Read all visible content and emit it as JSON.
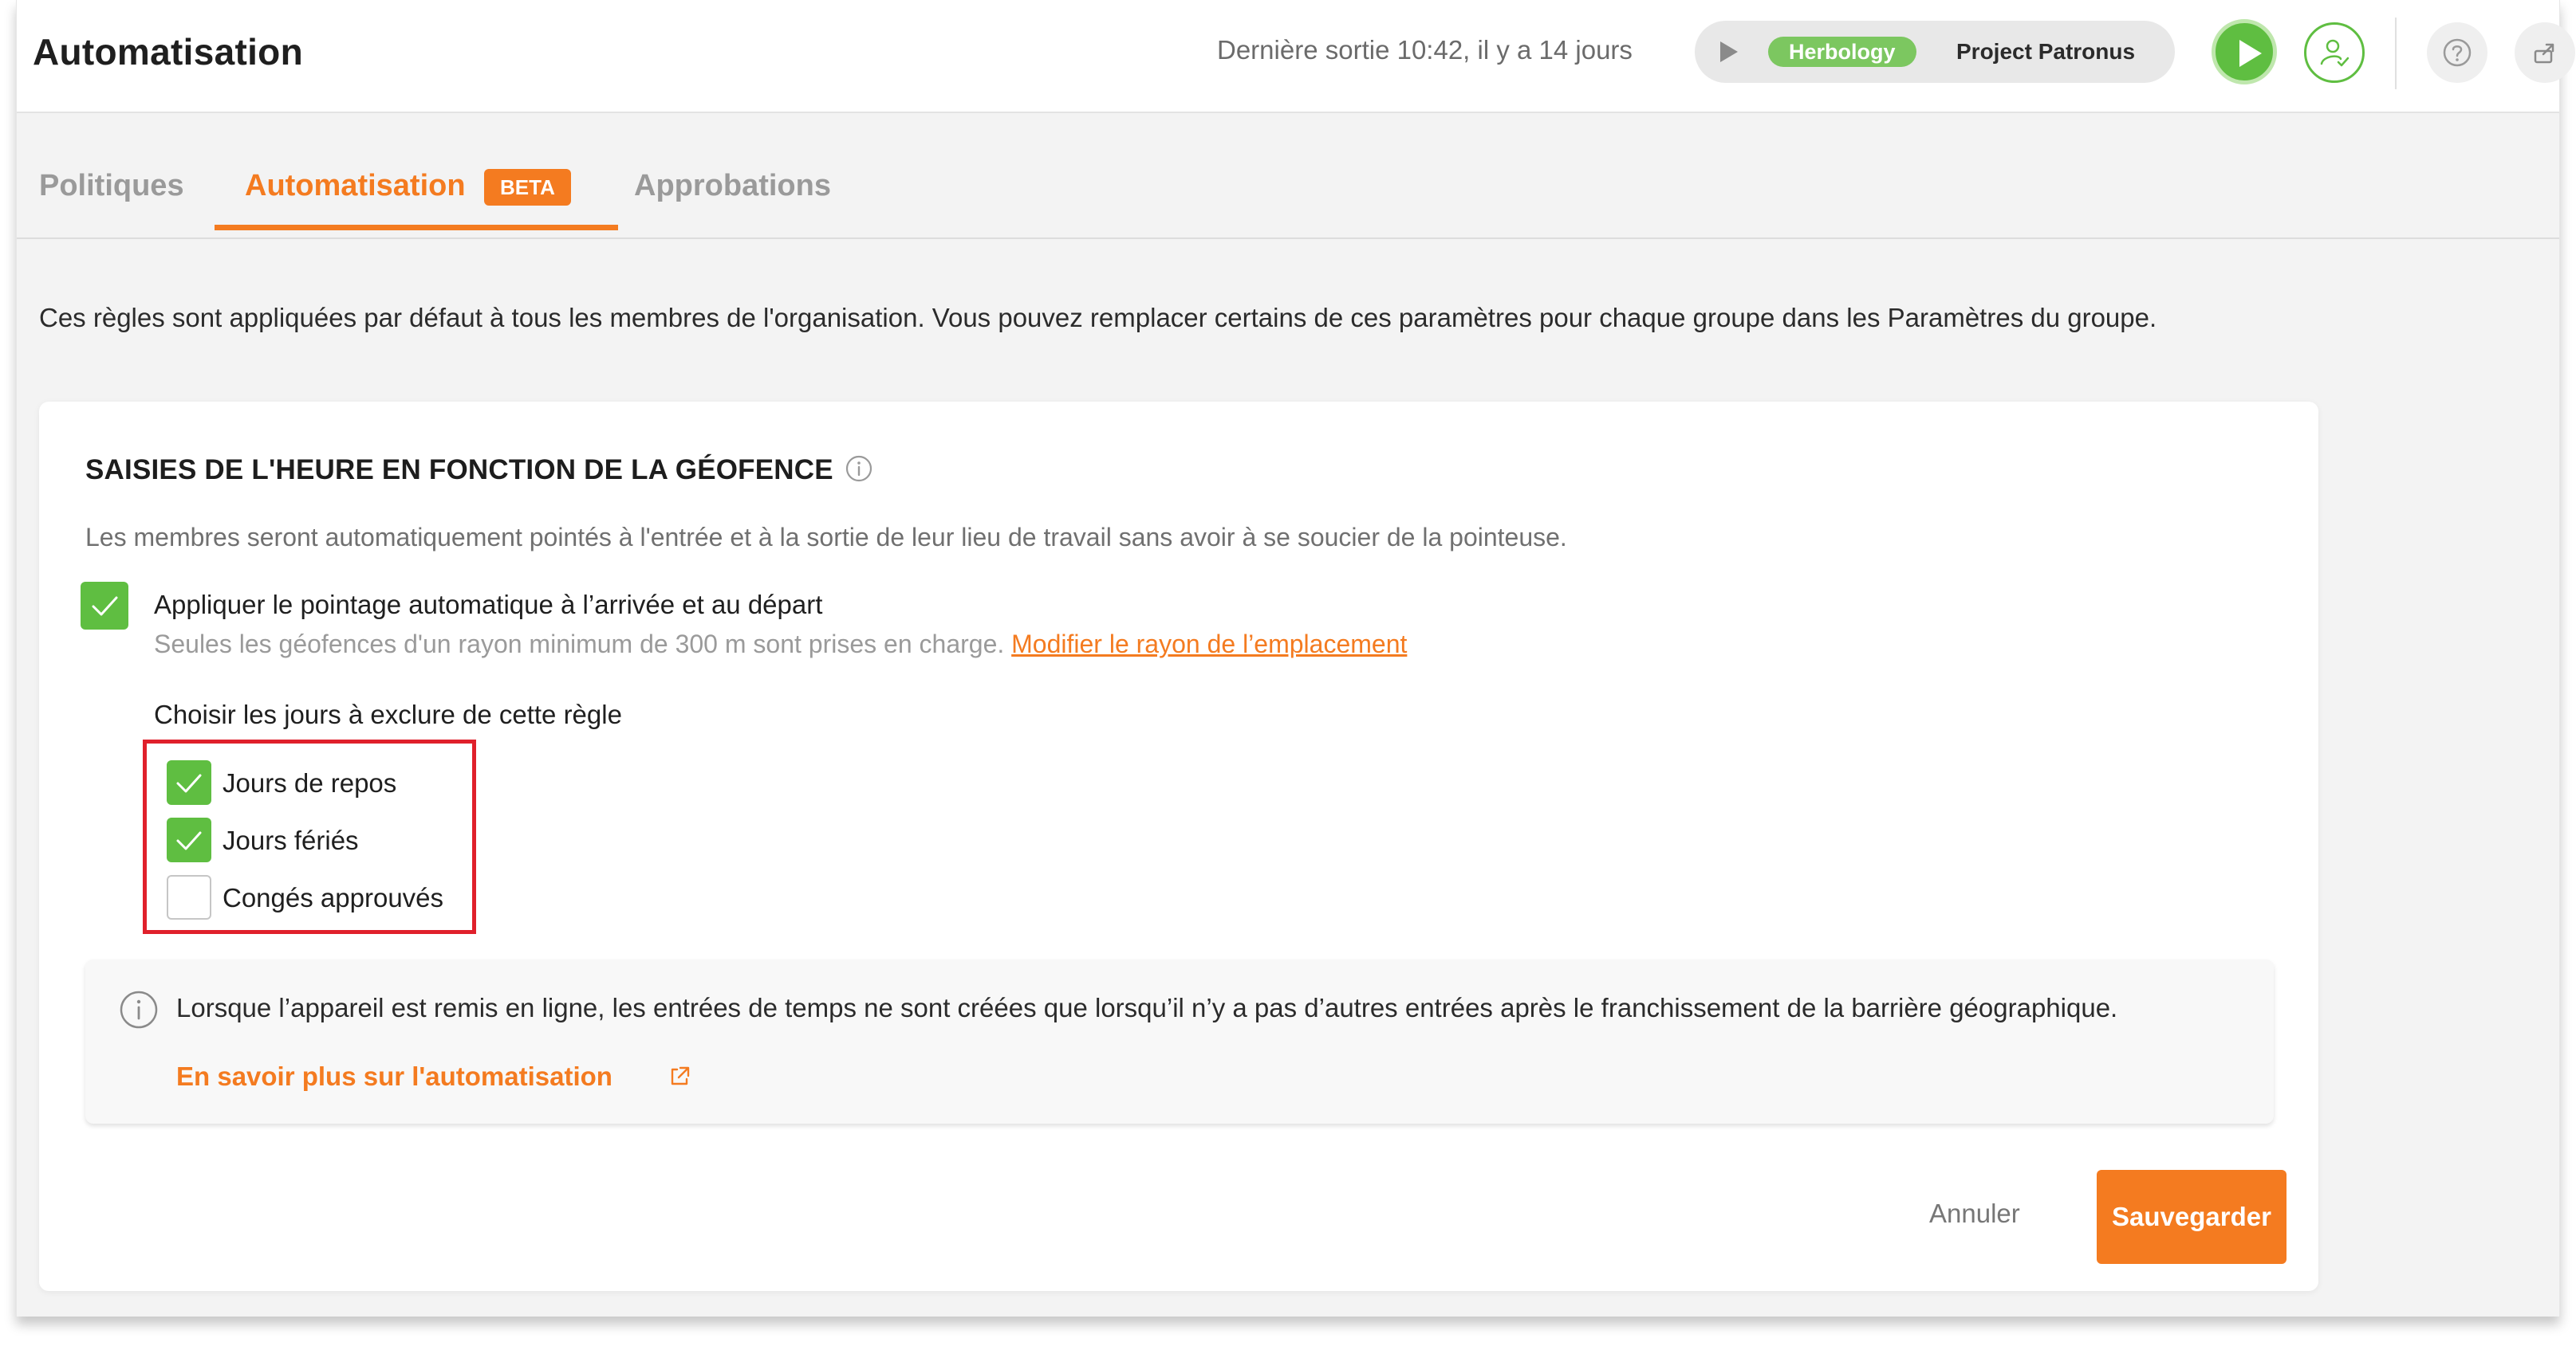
{
  "header": {
    "title": "Automatisation",
    "last_out": "Dernière sortie 10:42, il y a 14 jours",
    "timer": {
      "project_badge": "Herbology",
      "project_name": "Project Patronus"
    },
    "icons": [
      "play-icon",
      "user-check-icon",
      "help-icon",
      "share-icon"
    ]
  },
  "tabs": {
    "items": [
      {
        "label": "Politiques"
      },
      {
        "label": "Automatisation"
      },
      {
        "label": "Approbations"
      }
    ],
    "beta_label": "BETA",
    "active": "Automatisation"
  },
  "intro": "Ces règles sont appliquées par défaut à tous les membres de l'organisation. Vous pouvez remplacer certains de ces paramètres pour chaque groupe dans les Paramètres du groupe.",
  "card": {
    "title": "SAISIES DE L'HEURE EN FONCTION DE LA GÉOFENCE",
    "description": "Les membres seront automatiquement pointés à l'entrée et à la sortie de leur lieu de travail sans avoir à se soucier de la pointeuse.",
    "auto_clock": {
      "label": "Appliquer le pointage automatique à l’arrivée et au départ",
      "checked": true,
      "note": "Seules les géofences d'un rayon minimum de 300 m sont prises en charge.",
      "note_link": "Modifier le rayon de l’emplacement"
    },
    "exclude": {
      "label": "Choisir les jours à exclure de cette règle",
      "options": [
        {
          "label": "Jours de repos",
          "checked": true
        },
        {
          "label": "Jours fériés",
          "checked": true
        },
        {
          "label": "Congés approuvés",
          "checked": false
        }
      ]
    },
    "notice": {
      "text": "Lorsque l’appareil est remis en ligne, les entrées de temps ne sont créées que lorsqu’il n’y a pas d’autres entrées après le franchissement de la barrière géographique.",
      "link": "En savoir plus sur l'automatisation"
    },
    "actions": {
      "cancel": "Annuler",
      "save": "Sauvegarder"
    }
  },
  "colors": {
    "accent": "#f47b20",
    "success": "#5fbe41",
    "highlight": "#e0202b"
  }
}
